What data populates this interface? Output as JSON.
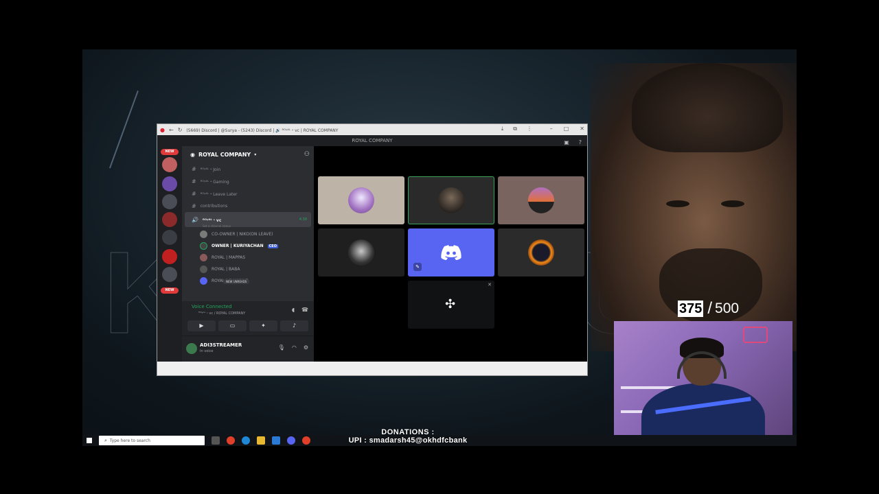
{
  "browser": {
    "tab_title": "(5669) Discord | @Surya - (5243) Discord | 🔊 ᴿᴼʸᴬᴸ・vc | ROYAL COMPANY"
  },
  "discord": {
    "window_title": "ROYAL COMPANY",
    "guild_name": "ROYAL COMPANY",
    "badges": {
      "new": "NEW"
    },
    "channels": [
      {
        "name": "ᴿᴼʸᴬᴸ・Join"
      },
      {
        "name": "ᴿᴼʸᴬᴸ・Gaming"
      },
      {
        "name": "ᴿᴼʸᴬᴸ・Leave Later"
      },
      {
        "name": "contributions"
      }
    ],
    "active_voice_channel": {
      "name": "ᴿᴼʸᴬᴸ・vc",
      "sub": "Set a channel status",
      "time": "4:38"
    },
    "members": [
      {
        "name": "CO-OWNER | NIKO(ON LEAVE)",
        "bold": false,
        "tag": ""
      },
      {
        "name": "OWNER | KURIYACHAN",
        "bold": true,
        "tag": "CEO"
      },
      {
        "name": "ROYAL | MAPPAS",
        "bold": false,
        "tag": ""
      },
      {
        "name": "ROYAL | BABA",
        "bold": false,
        "tag": ""
      },
      {
        "name": "ROYAL | SHUKKUR",
        "bold": false,
        "tag": ""
      }
    ],
    "new_unreads": "NEW UNREADS",
    "voice": {
      "status": "Voice Connected",
      "location": "ᴿᴼʸᴬᴸ・vc / ROYAL COMPANY"
    },
    "user": {
      "name": "ADI3STREAMER",
      "status": "In voice"
    }
  },
  "overlay": {
    "counter_current": "375",
    "counter_separator": "/",
    "counter_total": "500",
    "donations_title": "DONATIONS :",
    "donations_upi": "UPI : smadarsh45@okhdfcbank"
  },
  "taskbar": {
    "search_placeholder": "Type here to search"
  },
  "colors": {
    "discord_blurple": "#5865f2",
    "voice_green": "#23a55a",
    "new_badge": "#e03a3a"
  },
  "icons": [
    "back-icon",
    "reload-icon",
    "download-icon",
    "extensions-icon",
    "more-icon",
    "minimize-icon",
    "maximize-icon",
    "close-icon",
    "discord-logo-icon",
    "apps-grid-icon",
    "search-icon"
  ]
}
